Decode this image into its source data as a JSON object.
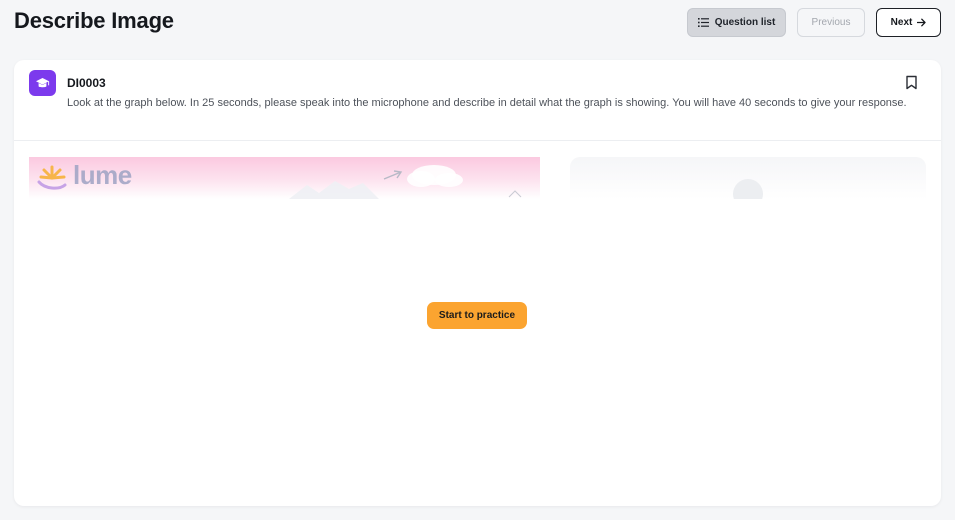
{
  "header": {
    "title": "Describe Image",
    "question_list_label": "Question list",
    "previous_label": "Previous",
    "next_label": "Next"
  },
  "question": {
    "id": "DI0003",
    "instructions": "Look at the graph below. In 25 seconds, please speak into the microphone and describe in detail what the graph is showing. You will have 40 seconds to give your response.",
    "bookmarked": false
  },
  "preview": {
    "logo_text": "lume"
  },
  "actions": {
    "start_label": "Start to practice"
  },
  "colors": {
    "accent_purple": "#7c3aed",
    "start_orange": "#fba430",
    "page_background": "#f5f6f8"
  },
  "icons": {
    "question_list": "list-icon",
    "next": "arrow-right-icon",
    "badge": "graduation-cap-icon",
    "bookmark": "bookmark-icon"
  }
}
